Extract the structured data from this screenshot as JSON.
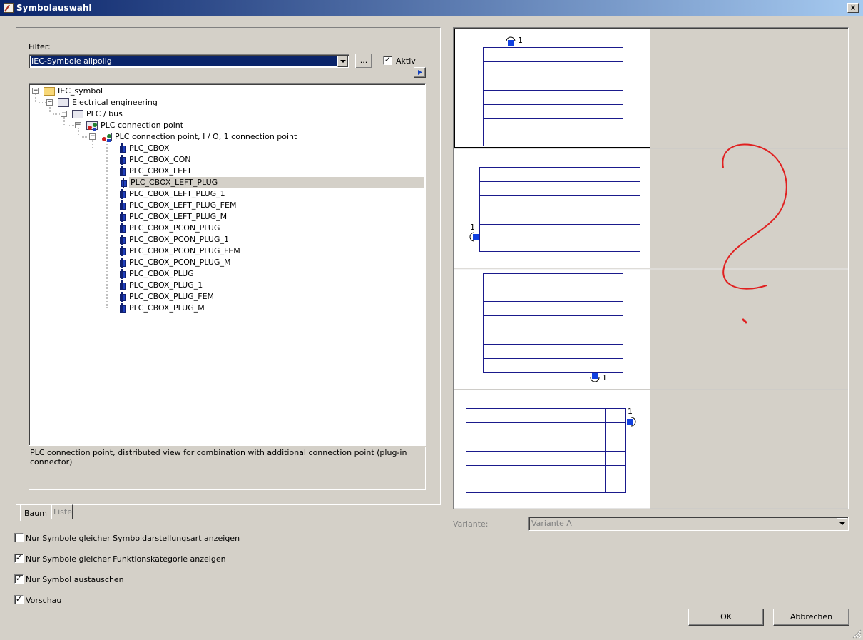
{
  "window": {
    "title": "Symbolauswahl",
    "close_glyph": "×"
  },
  "filter": {
    "label": "Filter:",
    "value": "IEC-Symbole allpolig",
    "more_button": "...",
    "aktiv_label": "Aktiv",
    "aktiv_checked": true
  },
  "tree": {
    "items": [
      {
        "label": "IEC_symbol",
        "expander": "−"
      },
      {
        "label": "Electrical engineering",
        "expander": "−"
      },
      {
        "label": "PLC / bus",
        "expander": "−"
      },
      {
        "label": "PLC connection point",
        "expander": "−"
      },
      {
        "label": "PLC connection point, I / O, 1 connection point",
        "expander": "−"
      },
      {
        "label": "PLC_CBOX"
      },
      {
        "label": "PLC_CBOX_CON"
      },
      {
        "label": "PLC_CBOX_LEFT"
      },
      {
        "label": "PLC_CBOX_LEFT_PLUG",
        "selected": true
      },
      {
        "label": "PLC_CBOX_LEFT_PLUG_1"
      },
      {
        "label": "PLC_CBOX_LEFT_PLUG_FEM"
      },
      {
        "label": "PLC_CBOX_LEFT_PLUG_M"
      },
      {
        "label": "PLC_CBOX_PCON_PLUG"
      },
      {
        "label": "PLC_CBOX_PCON_PLUG_1"
      },
      {
        "label": "PLC_CBOX_PCON_PLUG_FEM"
      },
      {
        "label": "PLC_CBOX_PCON_PLUG_M"
      },
      {
        "label": "PLC_CBOX_PLUG"
      },
      {
        "label": "PLC_CBOX_PLUG_1"
      },
      {
        "label": "PLC_CBOX_PLUG_FEM"
      },
      {
        "label": "PLC_CBOX_PLUG_M"
      }
    ]
  },
  "description": "PLC connection point, distributed view for combination with additional connection point (plug-in connector)",
  "tabs": {
    "baum": "Baum",
    "liste": "Liste"
  },
  "options": [
    {
      "label": "Nur Symbole gleicher Symboldarstellungsart anzeigen",
      "checked": false
    },
    {
      "label": "Nur Symbole gleicher Funktionskategorie anzeigen",
      "checked": true
    },
    {
      "label": "Nur Symbol austauschen",
      "checked": true
    },
    {
      "label": "Vorschau",
      "checked": true
    }
  ],
  "preview": {
    "connection_number": "1",
    "symbol_color": "#1a1a8c",
    "connector_color": "#1040e0"
  },
  "variant": {
    "label": "Variante:",
    "value": "Variante A"
  },
  "buttons": {
    "ok": "OK",
    "cancel": "Abbrechen"
  },
  "check_glyph": "✓"
}
